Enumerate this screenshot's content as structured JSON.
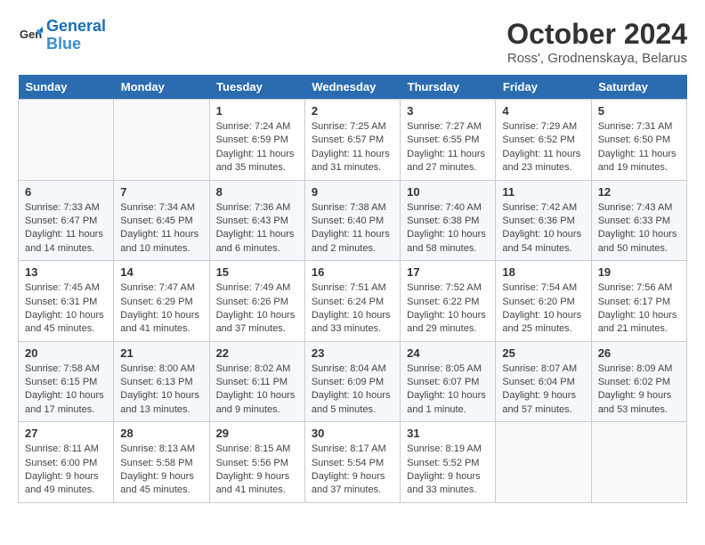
{
  "header": {
    "logo_line1": "General",
    "logo_line2": "Blue",
    "month": "October 2024",
    "location": "Ross', Grodnenskaya, Belarus"
  },
  "weekdays": [
    "Sunday",
    "Monday",
    "Tuesday",
    "Wednesday",
    "Thursday",
    "Friday",
    "Saturday"
  ],
  "weeks": [
    [
      {
        "day": "",
        "empty": true
      },
      {
        "day": "",
        "empty": true
      },
      {
        "day": "1",
        "sunrise": "7:24 AM",
        "sunset": "6:59 PM",
        "daylight": "11 hours and 35 minutes."
      },
      {
        "day": "2",
        "sunrise": "7:25 AM",
        "sunset": "6:57 PM",
        "daylight": "11 hours and 31 minutes."
      },
      {
        "day": "3",
        "sunrise": "7:27 AM",
        "sunset": "6:55 PM",
        "daylight": "11 hours and 27 minutes."
      },
      {
        "day": "4",
        "sunrise": "7:29 AM",
        "sunset": "6:52 PM",
        "daylight": "11 hours and 23 minutes."
      },
      {
        "day": "5",
        "sunrise": "7:31 AM",
        "sunset": "6:50 PM",
        "daylight": "11 hours and 19 minutes."
      }
    ],
    [
      {
        "day": "6",
        "sunrise": "7:33 AM",
        "sunset": "6:47 PM",
        "daylight": "11 hours and 14 minutes."
      },
      {
        "day": "7",
        "sunrise": "7:34 AM",
        "sunset": "6:45 PM",
        "daylight": "11 hours and 10 minutes."
      },
      {
        "day": "8",
        "sunrise": "7:36 AM",
        "sunset": "6:43 PM",
        "daylight": "11 hours and 6 minutes."
      },
      {
        "day": "9",
        "sunrise": "7:38 AM",
        "sunset": "6:40 PM",
        "daylight": "11 hours and 2 minutes."
      },
      {
        "day": "10",
        "sunrise": "7:40 AM",
        "sunset": "6:38 PM",
        "daylight": "10 hours and 58 minutes."
      },
      {
        "day": "11",
        "sunrise": "7:42 AM",
        "sunset": "6:36 PM",
        "daylight": "10 hours and 54 minutes."
      },
      {
        "day": "12",
        "sunrise": "7:43 AM",
        "sunset": "6:33 PM",
        "daylight": "10 hours and 50 minutes."
      }
    ],
    [
      {
        "day": "13",
        "sunrise": "7:45 AM",
        "sunset": "6:31 PM",
        "daylight": "10 hours and 45 minutes."
      },
      {
        "day": "14",
        "sunrise": "7:47 AM",
        "sunset": "6:29 PM",
        "daylight": "10 hours and 41 minutes."
      },
      {
        "day": "15",
        "sunrise": "7:49 AM",
        "sunset": "6:26 PM",
        "daylight": "10 hours and 37 minutes."
      },
      {
        "day": "16",
        "sunrise": "7:51 AM",
        "sunset": "6:24 PM",
        "daylight": "10 hours and 33 minutes."
      },
      {
        "day": "17",
        "sunrise": "7:52 AM",
        "sunset": "6:22 PM",
        "daylight": "10 hours and 29 minutes."
      },
      {
        "day": "18",
        "sunrise": "7:54 AM",
        "sunset": "6:20 PM",
        "daylight": "10 hours and 25 minutes."
      },
      {
        "day": "19",
        "sunrise": "7:56 AM",
        "sunset": "6:17 PM",
        "daylight": "10 hours and 21 minutes."
      }
    ],
    [
      {
        "day": "20",
        "sunrise": "7:58 AM",
        "sunset": "6:15 PM",
        "daylight": "10 hours and 17 minutes."
      },
      {
        "day": "21",
        "sunrise": "8:00 AM",
        "sunset": "6:13 PM",
        "daylight": "10 hours and 13 minutes."
      },
      {
        "day": "22",
        "sunrise": "8:02 AM",
        "sunset": "6:11 PM",
        "daylight": "10 hours and 9 minutes."
      },
      {
        "day": "23",
        "sunrise": "8:04 AM",
        "sunset": "6:09 PM",
        "daylight": "10 hours and 5 minutes."
      },
      {
        "day": "24",
        "sunrise": "8:05 AM",
        "sunset": "6:07 PM",
        "daylight": "10 hours and 1 minute."
      },
      {
        "day": "25",
        "sunrise": "8:07 AM",
        "sunset": "6:04 PM",
        "daylight": "9 hours and 57 minutes."
      },
      {
        "day": "26",
        "sunrise": "8:09 AM",
        "sunset": "6:02 PM",
        "daylight": "9 hours and 53 minutes."
      }
    ],
    [
      {
        "day": "27",
        "sunrise": "8:11 AM",
        "sunset": "6:00 PM",
        "daylight": "9 hours and 49 minutes."
      },
      {
        "day": "28",
        "sunrise": "8:13 AM",
        "sunset": "5:58 PM",
        "daylight": "9 hours and 45 minutes."
      },
      {
        "day": "29",
        "sunrise": "8:15 AM",
        "sunset": "5:56 PM",
        "daylight": "9 hours and 41 minutes."
      },
      {
        "day": "30",
        "sunrise": "8:17 AM",
        "sunset": "5:54 PM",
        "daylight": "9 hours and 37 minutes."
      },
      {
        "day": "31",
        "sunrise": "8:19 AM",
        "sunset": "5:52 PM",
        "daylight": "9 hours and 33 minutes."
      },
      {
        "day": "",
        "empty": true
      },
      {
        "day": "",
        "empty": true
      }
    ]
  ]
}
